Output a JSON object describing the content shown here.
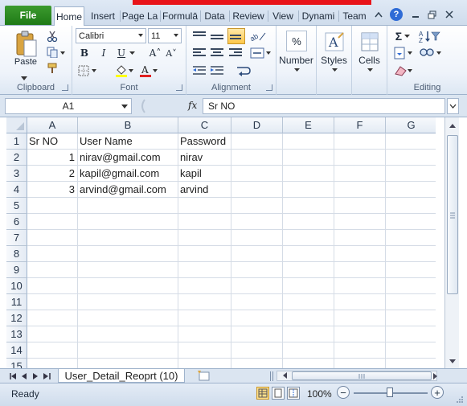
{
  "tabs": {
    "file": "File",
    "items": [
      "Home",
      "Insert",
      "Page La",
      "Formulā",
      "Data",
      "Review",
      "View",
      "Dynami",
      "Team"
    ]
  },
  "ribbon": {
    "clipboard": {
      "label": "Clipboard",
      "paste": "Paste"
    },
    "font": {
      "label": "Font",
      "name": "Calibri",
      "size": "11",
      "bold": "B",
      "italic": "I",
      "underline": "U",
      "grow": "A˄",
      "shrink": "A˅",
      "font_color_glyph": "A"
    },
    "alignment": {
      "label": "Alignment"
    },
    "number": {
      "label": "Number",
      "glyph": "%"
    },
    "styles": {
      "label": "Styles"
    },
    "cells": {
      "label": "Cells"
    },
    "editing": {
      "label": "Editing",
      "sum": "Σ"
    }
  },
  "formula_bar": {
    "name_box": "A1",
    "fx": "fx",
    "value": "Sr NO"
  },
  "sheet": {
    "columns": [
      "A",
      "B",
      "C",
      "D",
      "E",
      "F",
      "G"
    ],
    "rows": [
      "1",
      "2",
      "3",
      "4",
      "5",
      "6",
      "7",
      "8",
      "9",
      "10",
      "11",
      "12",
      "13",
      "14",
      "15"
    ],
    "cells": [
      [
        "Sr NO",
        "User Name",
        "Password"
      ],
      [
        "1",
        "nirav@gmail.com",
        "nirav"
      ],
      [
        "2",
        "kapil@gmail.com",
        "kapil"
      ],
      [
        "3",
        "arvind@gmail.com",
        "arvind"
      ]
    ]
  },
  "sheet_tab": {
    "name": "User_Detail_Reoprt (10)"
  },
  "status": {
    "text": "Ready",
    "zoom": "100%",
    "zoom_out": "−",
    "zoom_in": "+"
  },
  "colors": {
    "file_tab": "#1f7a17",
    "accent": "#2e6bd6",
    "title_highlight": "#e8141a"
  }
}
